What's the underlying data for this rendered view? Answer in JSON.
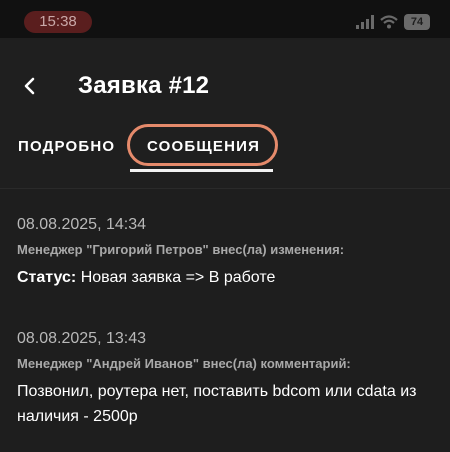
{
  "status_bar": {
    "time": "15:38",
    "battery": "74"
  },
  "header": {
    "title": "Заявка #12"
  },
  "tabs": [
    {
      "label": "ПОДРОБНО"
    },
    {
      "label": "СООБЩЕНИЯ",
      "active": true
    }
  ],
  "messages": [
    {
      "date": "08.08.2025, 14:34",
      "author": "Менеджер \"Григорий Петров\" внес(ла) изменения:",
      "field_label": "Статус:",
      "text": " Новая заявка => В работе"
    },
    {
      "date": "08.08.2025, 13:43",
      "author": "Менеджер \"Андрей Иванов\" внес(ла) комментарий:",
      "text": "Позвонил, роутера нет, поставить bdcom или cdata из наличия - 2500р"
    }
  ],
  "colors": {
    "background": "#1e1e1e",
    "highlight": "#e58a6b",
    "time_pill": "#5a1e1e"
  }
}
